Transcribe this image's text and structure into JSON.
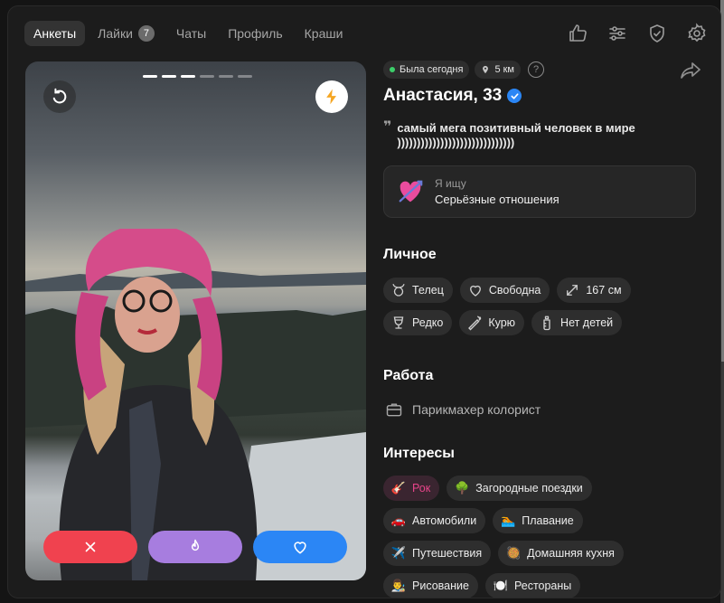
{
  "nav": {
    "tabs": [
      {
        "label": "Анкеты",
        "active": true
      },
      {
        "label": "Лайки",
        "badge": "7"
      },
      {
        "label": "Чаты"
      },
      {
        "label": "Профиль"
      },
      {
        "label": "Краши"
      }
    ],
    "icons": [
      "thumbs-up-icon",
      "filters-icon",
      "shield-check-icon",
      "gear-icon"
    ]
  },
  "photo": {
    "progress_total": 6,
    "progress_active": 3,
    "actions": [
      "close-icon",
      "flame-icon",
      "heart-icon"
    ]
  },
  "profile": {
    "status": "Была сегодня",
    "distance": "5 км",
    "help": "?",
    "name": "Анастасия, 33",
    "quote_mark": "❞",
    "quote_line1": "самый мега позитивный человек в мире",
    "quote_line2": "))))))))))))))))))))))))))))))",
    "looking_label": "Я ищу",
    "looking_value": "Серьёзные отношения"
  },
  "personal": {
    "title": "Личное",
    "chips": [
      {
        "label": "Телец",
        "icon": "taurus-icon"
      },
      {
        "label": "Свободна",
        "icon": "heart-outline-icon"
      },
      {
        "label": "167 см",
        "icon": "expand-icon"
      },
      {
        "label": "Редко",
        "icon": "wine-glass-icon"
      },
      {
        "label": "Курю",
        "icon": "cigarette-icon"
      },
      {
        "label": "Нет детей",
        "icon": "baby-bottle-icon"
      }
    ]
  },
  "work": {
    "title": "Работа",
    "value": "Парикмахер колорист"
  },
  "interests": {
    "title": "Интересы",
    "chips": [
      {
        "label": "Рок",
        "emoji": "🎸",
        "highlight": true
      },
      {
        "label": "Загородные поездки",
        "emoji": "🌳"
      },
      {
        "label": "Автомобили",
        "emoji": "🚗"
      },
      {
        "label": "Плавание",
        "emoji": "🏊"
      },
      {
        "label": "Путешествия",
        "emoji": "✈️"
      },
      {
        "label": "Домашняя кухня",
        "emoji": "🥘"
      },
      {
        "label": "Рисование",
        "emoji": "👨‍🎨"
      },
      {
        "label": "Рестораны",
        "emoji": "🍽️"
      }
    ]
  },
  "colors": {
    "accent_blue": "#2b86f5",
    "dislike_red": "#f0424f",
    "super_purple": "#a77ddf",
    "online_green": "#3ccf6a",
    "highlight_pink": "#e8448a"
  }
}
